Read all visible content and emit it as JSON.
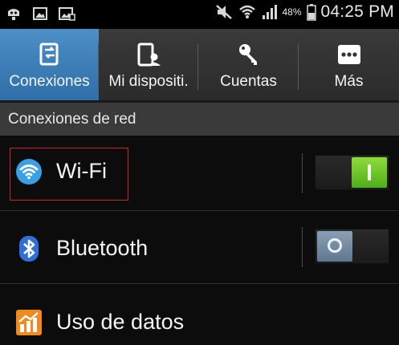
{
  "status_bar": {
    "battery_percent": "48%",
    "time": "04:25 PM",
    "icons": [
      "usb-debugging-icon",
      "screenshot-icon",
      "picture-icon",
      "mute-icon",
      "wifi-signal-icon",
      "cell-signal-icon",
      "battery-icon"
    ]
  },
  "tabs": [
    {
      "label": "Conexiones",
      "icon": "connections-icon",
      "selected": true
    },
    {
      "label": "Mi dispositi.",
      "icon": "my-device-icon",
      "selected": false
    },
    {
      "label": "Cuentas",
      "icon": "key-icon",
      "selected": false
    },
    {
      "label": "Más",
      "icon": "more-icon",
      "selected": false
    }
  ],
  "section": {
    "title": "Conexiones de red"
  },
  "rows": [
    {
      "label": "Wi-Fi",
      "icon": "wifi-icon",
      "toggle": "on",
      "highlighted": true
    },
    {
      "label": "Bluetooth",
      "icon": "bluetooth-icon",
      "toggle": "off"
    },
    {
      "label": "Uso de datos",
      "icon": "data-usage-icon"
    }
  ],
  "colors": {
    "tab_selected": "#3d7fbd",
    "toggle_on": "#6cc62a",
    "toggle_off": "#7990a7",
    "highlight_border": "#c8242c",
    "wifi_icon": "#39a0e8",
    "bluetooth_icon": "#2f6fd6",
    "data_usage_icon": "#f08a1c"
  }
}
